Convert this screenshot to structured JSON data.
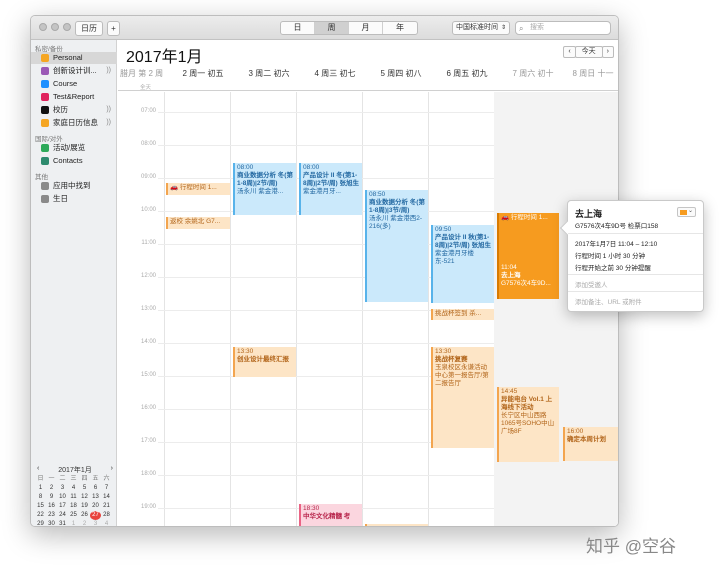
{
  "toolbar": {
    "calendars_label": "日历",
    "add_label": "+",
    "views": [
      "日",
      "周",
      "月",
      "年"
    ],
    "selected_view": "周",
    "timezone": "中国标准时间",
    "search_placeholder": "搜索"
  },
  "sidebar": {
    "section_private": "私密/备份",
    "private_items": [
      {
        "label": "Personal",
        "color": "#f5a623",
        "selected": true
      },
      {
        "label": "创新设计训...",
        "color": "#9b59b6",
        "shared": true
      },
      {
        "label": "Course",
        "color": "#1e90ff"
      },
      {
        "label": "Test&Report",
        "color": "#e0245e"
      },
      {
        "label": "校历",
        "color": "#111111",
        "shared": true
      },
      {
        "label": "家庭日历信息",
        "color": "#f5a623",
        "shared": true
      }
    ],
    "section_national": "国际/对外",
    "national_items": [
      {
        "label": "活动/展览",
        "color": "#2eaa5a"
      },
      {
        "label": "Contacts",
        "color": "#2e8b6e"
      }
    ],
    "section_other": "其他",
    "other_items": [
      {
        "label": "应用中找到",
        "color": "#8a8a8a"
      },
      {
        "label": "生日",
        "color": "#8a8a8a"
      }
    ],
    "mini_calendar": {
      "title": "2017年1月",
      "prev": "‹",
      "next": "›",
      "weekdays": [
        "日",
        "一",
        "二",
        "三",
        "四",
        "五",
        "六"
      ],
      "days": [
        "",
        "",
        "",
        "",
        "",
        "",
        "",
        "1",
        "2",
        "3",
        "4",
        "5",
        "6",
        "7",
        "8",
        "9",
        "10",
        "11",
        "12",
        "13",
        "14",
        "15",
        "16",
        "17",
        "18",
        "19",
        "20",
        "21",
        "22",
        "23",
        "24",
        "25",
        "26",
        "27",
        "28",
        "29",
        "30",
        "31",
        "1",
        "2",
        "3",
        "4"
      ],
      "today": "27"
    }
  },
  "main": {
    "title": "2017年1月",
    "prev": "‹",
    "today_label": "今天",
    "next": "›",
    "day_headers": [
      "腊月 第 2 周",
      "2 周一  初五",
      "3 周二  初六",
      "4 周三  初七",
      "5 周四  初八",
      "6 周五  初九",
      "7 周六  初十",
      "8 周日  十一"
    ],
    "allday_label": "全天",
    "hours": [
      "07:00",
      "08:00",
      "09:00",
      "10:00",
      "11:00",
      "12:00",
      "13:00",
      "14:00",
      "15:00",
      "16:00",
      "17:00",
      "18:00",
      "19:00"
    ],
    "events": [
      {
        "title": "行程时间 1...",
        "time": "",
        "detail": "",
        "color": "orange"
      },
      {
        "title": "返校 余姚北 G7...",
        "time": "",
        "detail": "",
        "color": "orange"
      },
      {
        "title": "商业数据分析 冬(第1-8周)|2节/周)",
        "time": "08:00",
        "detail": "汤永川 紫金港...",
        "color": "blue"
      },
      {
        "title": "产品设计 II 冬(第1-8周)|2节/周) 张旭生",
        "time": "08:00",
        "detail": "紫金港月牙...",
        "color": "blue"
      },
      {
        "title": "商业数据分析 冬(第1-8周)|3节/周)",
        "time": "08:50",
        "detail": "汤永川 紫金港西2-216(多)",
        "color": "blue"
      },
      {
        "title": "产品设计 II 秋(第1-8周)|2节/周) 张旭生",
        "time": "09:50",
        "detail": "紫金港月牙楼东-521",
        "color": "blue"
      },
      {
        "title": "行程时间 1...",
        "time": "",
        "detail": "",
        "color": "solid"
      },
      {
        "title": "去上海",
        "time": "11:04",
        "detail": "G7576次4车9D...",
        "color": "solid"
      },
      {
        "title": "挑战杯签到 杀...",
        "time": "",
        "detail": "",
        "color": "orange"
      },
      {
        "title": "创业设计最终汇报",
        "time": "13:30",
        "detail": "",
        "color": "orange"
      },
      {
        "title": "挑战杯复赛",
        "time": "13:30",
        "detail": "玉泉校区永谦活动中心第一报告厅/第二报告厅",
        "color": "orange"
      },
      {
        "title": "异能电台 Vol.1 上海线下活动",
        "time": "14:45",
        "detail": "长宁区中山西路1065号SOHO中山广场8F",
        "color": "orange"
      },
      {
        "title": "确定本周计划",
        "time": "16:00",
        "detail": "",
        "color": "orange"
      },
      {
        "title": "中华文化精髓 考",
        "time": "18:30",
        "detail": "",
        "color": "pink"
      }
    ]
  },
  "popover": {
    "title": "去上海",
    "subtitle": "G7576次4车9D号 检票口158",
    "datetime": "2017年1月7日  11:04 – 12:10",
    "travel": "行程时间 1 小时 30 分钟",
    "reminder": "行程开始之前 30 分钟提醒",
    "add_invitee": "添加受邀人",
    "add_notes": "添加备注、URL 或附件"
  },
  "colors": {
    "accent_orange": "#f69b1f",
    "event_blue": "#58b3ea",
    "today_red": "#e8433d"
  },
  "watermark": "知乎 @空谷"
}
